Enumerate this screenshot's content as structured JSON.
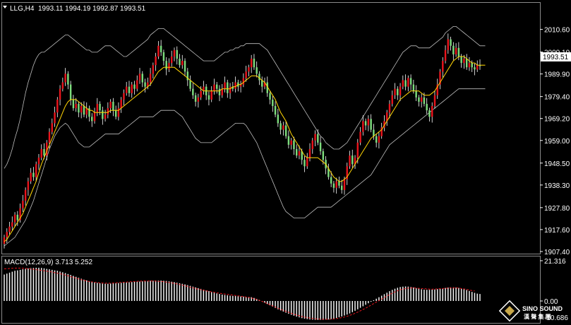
{
  "header": {
    "menu_icon": "triangle-down-icon",
    "symbol": "LLG,H4",
    "ohlc": "1993.11 1994.19 1992.87 1993.51"
  },
  "current_price_label": "1993.51",
  "macd_header": "MACD(12,26,9) 3.713 5.252",
  "macd_axis": {
    "top_label": "21.316",
    "zero_label": "0.00",
    "bottom_label": "-10.686"
  },
  "logo": {
    "line1": "SINO SOUND",
    "line2": "漢 聲 集 團"
  },
  "colors": {
    "background": "#000000",
    "up_candle": "#e8141c",
    "down_candle": "#7ddc7d",
    "wick": "#ffffff",
    "bollinger": "#bfbfbf",
    "ma_line": "#ffd400",
    "macd_histogram": "#ffffff",
    "macd_signal": "#e8141c",
    "frame": "#8a8a8a"
  },
  "chart_data": [
    {
      "type": "candlestick",
      "title": "LLG,H4",
      "ylim": [
        1907.4,
        2015.4
      ],
      "y_ticks": [
        "2010.60",
        "2000.10",
        "1989.90",
        "1979.40",
        "1969.20",
        "1959.00",
        "1948.50",
        "1938.30",
        "1927.80",
        "1917.60",
        "1907.40"
      ],
      "y_tick_values": [
        2010.6,
        2000.1,
        1989.9,
        1979.4,
        1969.2,
        1959.0,
        1948.5,
        1938.3,
        1927.8,
        1917.6,
        1907.4
      ],
      "overlays": [
        "Bollinger Bands (upper, middle, lower)",
        "Moving average (yellow)"
      ],
      "close": [
        1914.0,
        1916.5,
        1919.0,
        1921.0,
        1924.5,
        1922.0,
        1927.5,
        1931.0,
        1936.0,
        1940.0,
        1944.0,
        1942.0,
        1948.0,
        1951.0,
        1955.0,
        1952.0,
        1958.0,
        1963.0,
        1967.0,
        1972.0,
        1978.0,
        1983.0,
        1986.0,
        1990.0,
        1985.0,
        1978.0,
        1974.0,
        1976.0,
        1972.0,
        1975.0,
        1971.0,
        1974.0,
        1970.0,
        1968.0,
        1972.0,
        1976.0,
        1973.0,
        1969.0,
        1971.0,
        1974.0,
        1977.0,
        1973.0,
        1970.0,
        1974.0,
        1978.0,
        1981.0,
        1984.0,
        1981.0,
        1985.0,
        1983.0,
        1987.0,
        1990.0,
        1986.0,
        1984.0,
        1986.0,
        1990.0,
        1994.0,
        1998.0,
        2003.0,
        2000.0,
        1996.0,
        1992.0,
        1995.0,
        1998.0,
        2001.0,
        1997.0,
        1994.0,
        1996.0,
        1991.0,
        1987.0,
        1983.0,
        1980.0,
        1977.0,
        1979.0,
        1982.0,
        1984.0,
        1980.0,
        1978.0,
        1982.0,
        1985.0,
        1983.0,
        1980.0,
        1983.0,
        1986.0,
        1981.0,
        1984.0,
        1983.0,
        1986.0,
        1984.0,
        1985.0,
        1988.0,
        1991.0,
        1993.0,
        1997.0,
        1993.0,
        1990.0,
        1987.0,
        1984.0,
        1986.0,
        1981.0,
        1978.0,
        1975.0,
        1971.0,
        1967.0,
        1964.0,
        1966.0,
        1961.0,
        1957.0,
        1959.0,
        1955.0,
        1952.0,
        1954.0,
        1950.0,
        1947.0,
        1951.0,
        1955.0,
        1959.0,
        1962.0,
        1958.0,
        1954.0,
        1950.0,
        1946.0,
        1942.0,
        1939.0,
        1937.0,
        1940.0,
        1938.0,
        1936.0,
        1941.0,
        1947.0,
        1952.0,
        1948.0,
        1951.0,
        1958.0,
        1963.0,
        1968.0,
        1966.0,
        1969.0,
        1964.0,
        1961.0,
        1958.0,
        1961.0,
        1965.0,
        1968.0,
        1972.0,
        1976.0,
        1980.0,
        1983.0,
        1980.0,
        1984.0,
        1987.0,
        1984.0,
        1988.0,
        1985.0,
        1982.0,
        1979.0,
        1977.0,
        1979.0,
        1976.0,
        1973.0,
        1970.0,
        1975.0,
        1980.0,
        1985.0,
        1991.0,
        1996.0,
        2001.0,
        2006.0,
        2003.0,
        1999.0,
        2002.0,
        1998.0,
        1995.0,
        1997.0,
        1993.0,
        1995.0,
        1993.0,
        1992.0,
        1994.0,
        1993.5
      ],
      "bb_upper": [
        1946,
        1948,
        1951,
        1955,
        1960,
        1964,
        1969,
        1975,
        1981,
        1986,
        1990,
        1994,
        1997,
        1999,
        2000,
        2000,
        2001,
        2002,
        2003,
        2004,
        2005,
        2006,
        2007,
        2008,
        2008,
        2007,
        2006,
        2005,
        2004,
        2003,
        2002,
        2001,
        2001,
        2000,
        2000,
        2000,
        2001,
        2002,
        2003,
        2003,
        2003,
        2002,
        2001,
        2000,
        1999,
        1998,
        1998,
        1999,
        2000,
        2001,
        2002,
        2003,
        2004,
        2005,
        2006,
        2008,
        2009,
        2010,
        2011,
        2011,
        2011,
        2010,
        2009,
        2008,
        2007,
        2006,
        2005,
        2004,
        2003,
        2002,
        2001,
        2000,
        1999,
        1998,
        1997,
        1996,
        1996,
        1996,
        1996,
        1996,
        1997,
        1998,
        1999,
        2000,
        2000,
        2001,
        2001,
        2002,
        2002,
        2003,
        2003,
        2004,
        2004,
        2004,
        2004,
        2004,
        2004,
        2003,
        2002,
        2001,
        1999,
        1997,
        1995,
        1993,
        1991,
        1989,
        1987,
        1985,
        1983,
        1981,
        1979,
        1977,
        1975,
        1973,
        1971,
        1969,
        1967,
        1965,
        1963,
        1961,
        1960,
        1958,
        1957,
        1956,
        1955,
        1955,
        1955,
        1956,
        1957,
        1958,
        1960,
        1962,
        1964,
        1966,
        1968,
        1970,
        1972,
        1974,
        1976,
        1978,
        1980,
        1982,
        1984,
        1986,
        1988,
        1990,
        1992,
        1994,
        1996,
        1998,
        2000,
        2001,
        2002,
        2003,
        2003,
        2003,
        2002,
        2002,
        2002,
        2002,
        2002,
        2003,
        2004,
        2005,
        2006,
        2007,
        2009,
        2010,
        2011,
        2012,
        2012,
        2011,
        2010,
        2009,
        2008,
        2007,
        2006,
        2005,
        2004,
        2003,
        2003,
        2003
      ],
      "bb_lower": [
        1910,
        1911,
        1912,
        1913,
        1914,
        1916,
        1918,
        1920,
        1922,
        1925,
        1928,
        1931,
        1935,
        1939,
        1943,
        1947,
        1951,
        1955,
        1958,
        1961,
        1963,
        1965,
        1966,
        1967,
        1966,
        1964,
        1962,
        1960,
        1958,
        1957,
        1956,
        1956,
        1956,
        1957,
        1958,
        1959,
        1960,
        1961,
        1962,
        1962,
        1962,
        1962,
        1962,
        1962,
        1963,
        1964,
        1965,
        1966,
        1967,
        1968,
        1969,
        1970,
        1970,
        1970,
        1970,
        1970,
        1970,
        1971,
        1972,
        1973,
        1973,
        1973,
        1973,
        1973,
        1973,
        1972,
        1971,
        1970,
        1968,
        1966,
        1964,
        1962,
        1960,
        1959,
        1958,
        1958,
        1958,
        1958,
        1958,
        1959,
        1960,
        1961,
        1962,
        1963,
        1964,
        1965,
        1966,
        1967,
        1967,
        1967,
        1967,
        1966,
        1964,
        1962,
        1960,
        1958,
        1955,
        1952,
        1949,
        1946,
        1943,
        1940,
        1937,
        1934,
        1931,
        1928,
        1926,
        1925,
        1924,
        1923,
        1923,
        1923,
        1923,
        1923,
        1924,
        1925,
        1926,
        1927,
        1928,
        1928,
        1928,
        1928,
        1928,
        1928,
        1929,
        1930,
        1931,
        1932,
        1933,
        1934,
        1935,
        1936,
        1937,
        1938,
        1939,
        1940,
        1941,
        1942,
        1943,
        1945,
        1947,
        1949,
        1951,
        1953,
        1955,
        1957,
        1958,
        1959,
        1960,
        1961,
        1962,
        1963,
        1964,
        1965,
        1966,
        1967,
        1968,
        1969,
        1970,
        1971,
        1972,
        1973,
        1974,
        1975,
        1976,
        1977,
        1978,
        1979,
        1980,
        1981,
        1982,
        1983,
        1983,
        1983,
        1983,
        1983,
        1983,
        1983,
        1983,
        1983,
        1983,
        1983
      ],
      "ma": [
        1912,
        1913,
        1915,
        1917,
        1919,
        1921,
        1923,
        1925,
        1928,
        1931,
        1934,
        1937,
        1940,
        1944,
        1948,
        1951,
        1954,
        1957,
        1960,
        1963,
        1966,
        1969,
        1972,
        1975,
        1977,
        1978,
        1978,
        1978,
        1977,
        1976,
        1975,
        1974,
        1973,
        1973,
        1972,
        1972,
        1972,
        1972,
        1972,
        1972,
        1973,
        1973,
        1973,
        1973,
        1974,
        1975,
        1976,
        1977,
        1978,
        1979,
        1980,
        1981,
        1982,
        1983,
        1984,
        1985,
        1987,
        1989,
        1991,
        1992,
        1993,
        1993,
        1993,
        1993,
        1993,
        1992,
        1991,
        1990,
        1989,
        1988,
        1987,
        1986,
        1985,
        1984,
        1983,
        1982,
        1982,
        1982,
        1982,
        1982,
        1982,
        1982,
        1983,
        1983,
        1983,
        1983,
        1984,
        1984,
        1985,
        1985,
        1986,
        1987,
        1988,
        1989,
        1989,
        1989,
        1988,
        1987,
        1986,
        1984,
        1982,
        1980,
        1978,
        1975,
        1972,
        1970,
        1968,
        1965,
        1962,
        1960,
        1958,
        1956,
        1954,
        1952,
        1951,
        1951,
        1951,
        1951,
        1951,
        1950,
        1949,
        1948,
        1946,
        1944,
        1942,
        1941,
        1940,
        1940,
        1941,
        1942,
        1944,
        1946,
        1948,
        1950,
        1952,
        1954,
        1956,
        1958,
        1960,
        1961,
        1962,
        1963,
        1964,
        1966,
        1968,
        1970,
        1972,
        1974,
        1976,
        1978,
        1979,
        1980,
        1981,
        1982,
        1982,
        1982,
        1982,
        1981,
        1980,
        1980,
        1980,
        1981,
        1982,
        1984,
        1986,
        1988,
        1990,
        1992,
        1994,
        1996,
        1997,
        1998,
        1998,
        1998,
        1997,
        1996,
        1995,
        1995,
        1994,
        1994,
        1994,
        1994
      ]
    },
    {
      "type": "bar",
      "title": "MACD(12,26,9) 3.713 5.252",
      "ylim": [
        -10.686,
        21.316
      ],
      "histogram": [
        14,
        14.5,
        15,
        15.5,
        16,
        16.2,
        16.5,
        16.8,
        17,
        17.2,
        17.4,
        17.5,
        17.6,
        17.6,
        17.5,
        17.3,
        17,
        16.8,
        16.5,
        16.2,
        16,
        15.6,
        15.2,
        14.8,
        14.3,
        13.8,
        13.3,
        12.8,
        12.3,
        11.8,
        11.3,
        10.9,
        10.5,
        10.2,
        9.9,
        9.6,
        9.4,
        9.2,
        9.1,
        9.1,
        9.2,
        9.3,
        9.4,
        9.5,
        9.6,
        9.7,
        9.8,
        9.9,
        10,
        10.1,
        10.2,
        10.3,
        10.4,
        10.5,
        10.6,
        10.7,
        10.7,
        10.8,
        10.8,
        10.8,
        10.7,
        10.6,
        10.4,
        10.2,
        10,
        9.7,
        9.4,
        9.1,
        8.8,
        8.4,
        8,
        7.6,
        7.2,
        6.8,
        6.4,
        6,
        5.6,
        5.2,
        4.8,
        4.4,
        4,
        3.7,
        3.4,
        3.2,
        3,
        2.8,
        2.7,
        2.6,
        2.5,
        2.4,
        2.3,
        2.2,
        2.1,
        2,
        1.6,
        1.1,
        0.5,
        -0.2,
        -0.9,
        -1.6,
        -2.3,
        -3,
        -3.7,
        -4.4,
        -5,
        -5.6,
        -6.2,
        -6.8,
        -7.3,
        -7.8,
        -8.3,
        -8.7,
        -9.1,
        -9.4,
        -9.6,
        -9.8,
        -9.9,
        -10,
        -10,
        -10,
        -10,
        -9.9,
        -9.8,
        -9.6,
        -9.3,
        -9,
        -8.6,
        -8.2,
        -7.7,
        -7.2,
        -6.6,
        -5.9,
        -5.2,
        -4.4,
        -3.6,
        -2.8,
        -2,
        -1.2,
        -0.4,
        0.4,
        1.2,
        2,
        2.8,
        3.6,
        4.4,
        5.2,
        5.9,
        6.5,
        7,
        7.4,
        7.6,
        7.7,
        7.6,
        7.4,
        7.1,
        6.8,
        6.5,
        6.2,
        6,
        5.9,
        5.9,
        6,
        6.1,
        6.3,
        6.5,
        6.7,
        6.9,
        7.1,
        7.2,
        7.2,
        7.1,
        6.9,
        6.6,
        6.2,
        5.8,
        5.3,
        4.8,
        4.3,
        3.9,
        3.7
      ],
      "signal": [
        17,
        17.1,
        17.2,
        17.3,
        17.4,
        17.4,
        17.4,
        17.3,
        17.2,
        17.1,
        17,
        16.8,
        16.6,
        16.4,
        16.2,
        16,
        15.8,
        15.6,
        15.3,
        15,
        14.7,
        14.4,
        14.1,
        13.7,
        13.3,
        12.9,
        12.5,
        12.1,
        11.7,
        11.3,
        10.9,
        10.6,
        10.3,
        10.1,
        9.9,
        9.7,
        9.6,
        9.5,
        9.4,
        9.4,
        9.4,
        9.5,
        9.6,
        9.7,
        9.8,
        9.9,
        10,
        10.1,
        10.2,
        10.3,
        10.4,
        10.5,
        10.5,
        10.6,
        10.6,
        10.6,
        10.6,
        10.5,
        10.4,
        10.3,
        10.2,
        10,
        9.8,
        9.6,
        9.3,
        9,
        8.7,
        8.4,
        8,
        7.7,
        7.3,
        7,
        6.6,
        6.3,
        6,
        5.7,
        5.4,
        5.1,
        4.8,
        4.6,
        4.3,
        4.1,
        3.9,
        3.7,
        3.5,
        3.3,
        3.1,
        2.9,
        2.7,
        2.5,
        2.3,
        2.1,
        1.9,
        1.6,
        1.2,
        0.8,
        0.3,
        -0.2,
        -0.8,
        -1.4,
        -2,
        -2.6,
        -3.2,
        -3.8,
        -4.4,
        -5,
        -5.5,
        -6,
        -6.5,
        -7,
        -7.4,
        -7.8,
        -8.2,
        -8.5,
        -8.8,
        -9,
        -9.2,
        -9.4,
        -9.5,
        -9.6,
        -9.7,
        -9.7,
        -9.7,
        -9.6,
        -9.5,
        -9.3,
        -9.1,
        -8.8,
        -8.5,
        -8.1,
        -7.6,
        -7.1,
        -6.5,
        -5.9,
        -5.2,
        -4.5,
        -3.8,
        -3,
        -2.2,
        -1.4,
        -0.6,
        0.2,
        1,
        1.8,
        2.6,
        3.4,
        4.1,
        4.8,
        5.4,
        5.9,
        6.3,
        6.6,
        6.8,
        6.9,
        6.9,
        6.8,
        6.7,
        6.6,
        6.5,
        6.4,
        6.3,
        6.3,
        6.3,
        6.4,
        6.5,
        6.6,
        6.7,
        6.8,
        6.9,
        6.9,
        6.9,
        6.8,
        6.6,
        6.4,
        6.1,
        5.8,
        5.5,
        5.3
      ]
    }
  ]
}
